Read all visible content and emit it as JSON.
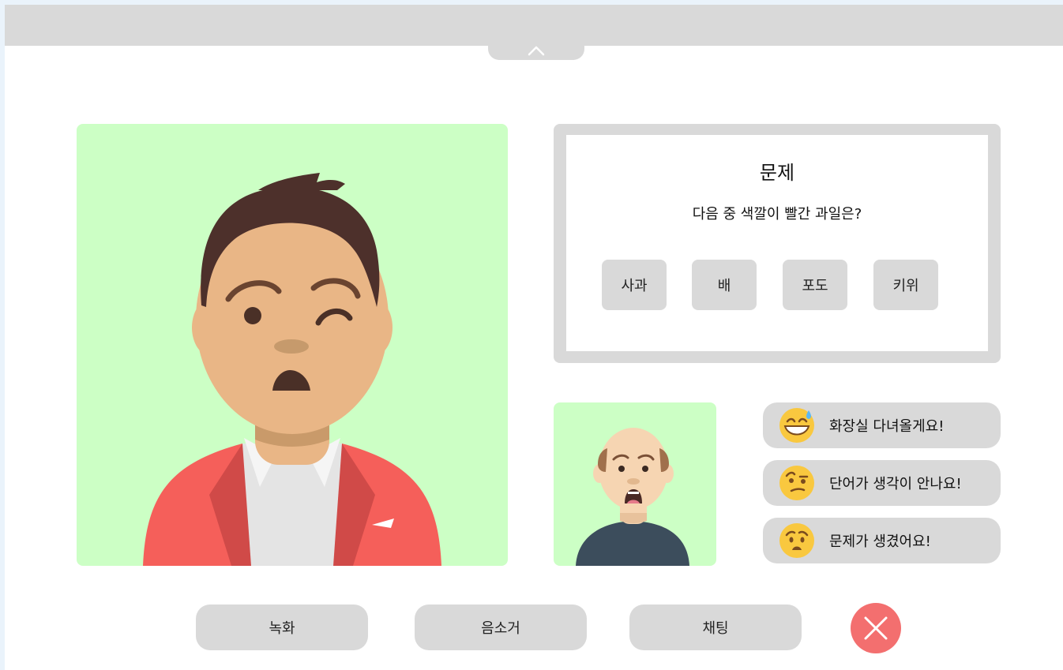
{
  "header": {
    "collapse_icon": "chevron-up-icon"
  },
  "quiz": {
    "title": "문제",
    "question": "다음 중 색깔이 빨간 과일은?",
    "answers": [
      "사과",
      "배",
      "포도",
      "키위"
    ]
  },
  "quick_messages": [
    {
      "emoji": "sweat-smile-emoji",
      "label": "화장실 다녀올게요!"
    },
    {
      "emoji": "raised-eyebrow-emoji",
      "label": "단어가 생각이 안나요!"
    },
    {
      "emoji": "worried-emoji",
      "label": "문제가 생겼어요!"
    }
  ],
  "controls": {
    "record": "녹화",
    "mute": "음소거",
    "chat": "채팅",
    "close_icon": "close-icon"
  },
  "colors": {
    "video_bg": "#ccffc5",
    "panel_gray": "#d9d9d9",
    "close_red": "#f36f6f",
    "jacket_red": "#f55f5a"
  }
}
